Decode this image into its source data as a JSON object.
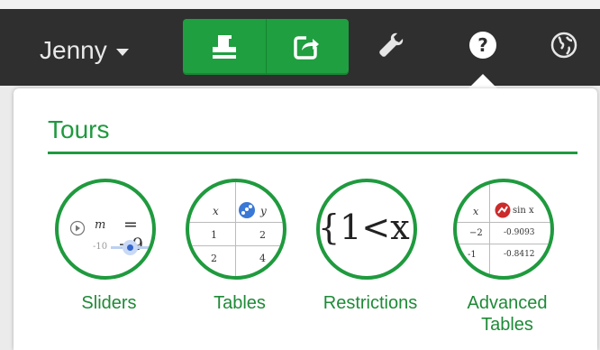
{
  "header": {
    "user_name": "Jenny",
    "buttons": [
      {
        "icon": "print-icon"
      },
      {
        "icon": "share-icon"
      }
    ],
    "tools": [
      {
        "icon": "wrench-icon"
      },
      {
        "icon": "help-icon"
      },
      {
        "icon": "globe-icon"
      }
    ],
    "colors": {
      "bar": "#2f2f2f",
      "accent_green": "#1f9f3f"
    }
  },
  "panel": {
    "title": "Tours",
    "tours": [
      {
        "label": "Sliders",
        "preview": {
          "eq_left": "m",
          "eq_right": "= −9",
          "min": "-10"
        }
      },
      {
        "label": "Tables",
        "preview": {
          "col_x": "x",
          "col_y": "y",
          "rows": [
            [
              "1",
              "2"
            ],
            [
              "2",
              "4"
            ]
          ]
        }
      },
      {
        "label": "Restrictions",
        "preview": {
          "expr": "{1<x"
        }
      },
      {
        "label": "Advanced\nTables",
        "label_line1": "Advanced",
        "label_line2": "Tables",
        "preview": {
          "col_x": "x",
          "col_f": "sin x",
          "rows": [
            [
              "−2",
              "-0.9093"
            ],
            [
              "-1",
              "-0.8412"
            ]
          ]
        }
      }
    ]
  }
}
